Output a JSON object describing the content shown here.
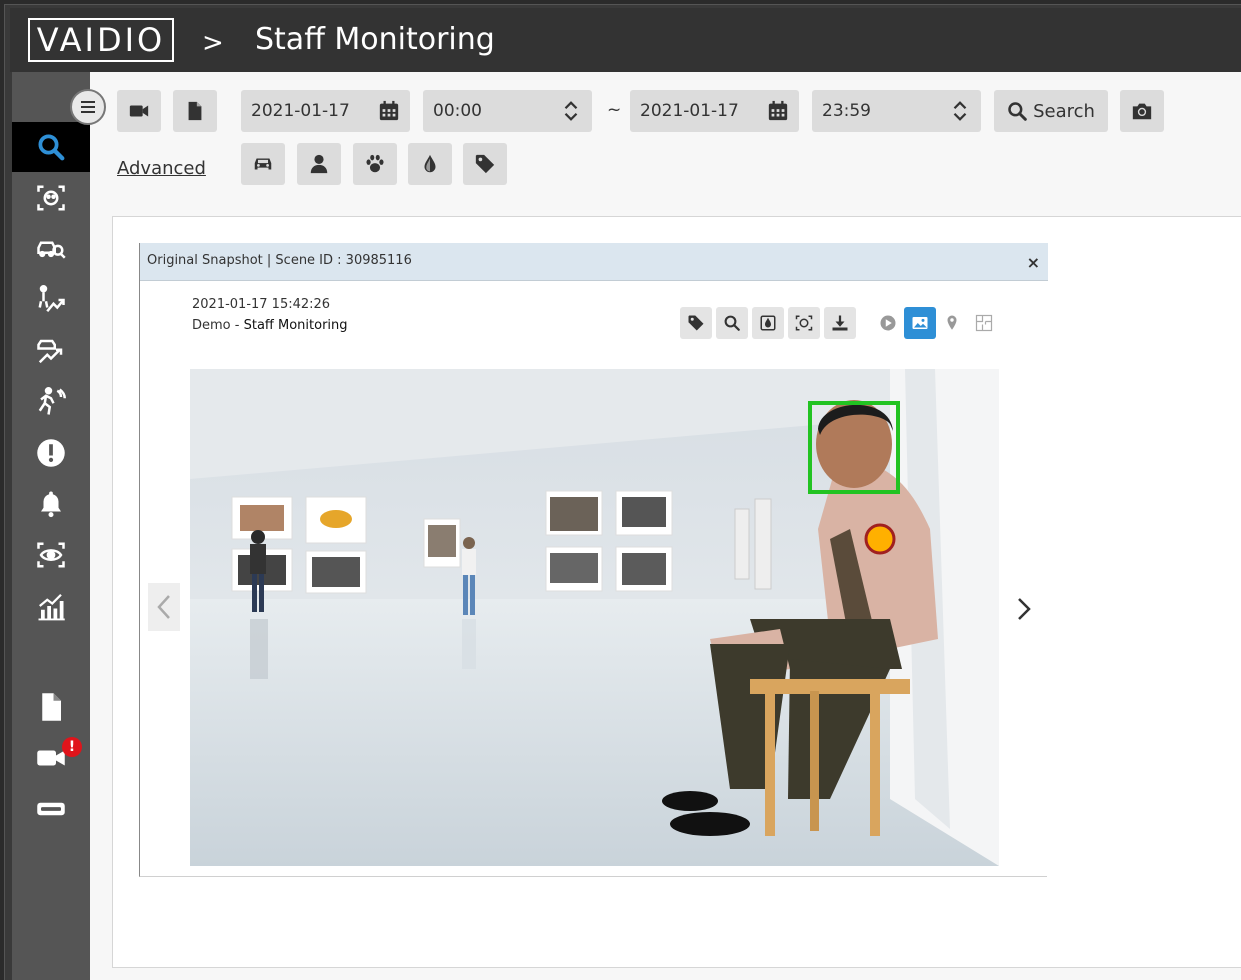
{
  "header": {
    "logo_text": "VAIDIO",
    "breadcrumb_separator": ">",
    "title": "Staff Monitoring"
  },
  "toolbar": {
    "start_date": "2021-01-17",
    "start_time": "00:00",
    "range_separator": "~",
    "end_date": "2021-01-17",
    "end_time": "23:59",
    "search_label": "Search",
    "advanced_label": "Advanced"
  },
  "sidebar": {
    "items": [
      {
        "name": "search",
        "icon": "search-icon",
        "active": true
      },
      {
        "name": "face",
        "icon": "face-scan-icon"
      },
      {
        "name": "vehicle-search",
        "icon": "car-search-icon"
      },
      {
        "name": "people-trend",
        "icon": "person-trend-icon"
      },
      {
        "name": "vehicle-trend",
        "icon": "car-trend-icon"
      },
      {
        "name": "intrusion",
        "icon": "person-running-icon"
      },
      {
        "name": "alerts",
        "icon": "exclamation-icon"
      },
      {
        "name": "notifications",
        "icon": "bell-icon"
      },
      {
        "name": "watch",
        "icon": "eye-scan-icon"
      },
      {
        "name": "analytics",
        "icon": "bar-chart-icon"
      },
      {
        "name": "reports",
        "icon": "document-icon"
      },
      {
        "name": "cameras",
        "icon": "camera-icon",
        "badge": "!"
      },
      {
        "name": "devices",
        "icon": "device-icon"
      }
    ]
  },
  "snapshot": {
    "title": "Original Snapshot | Scene ID : 30985116",
    "close": "×",
    "timestamp": "2021-01-17 15:42:26",
    "camera_group": "Demo",
    "camera_sep": " - ",
    "camera_name": "Staff Monitoring"
  },
  "colors": {
    "header": "#333333",
    "sidebar": "#555555",
    "accent": "#2e8fd6",
    "detection_box": "#22c322",
    "badge": "#e0141b"
  }
}
